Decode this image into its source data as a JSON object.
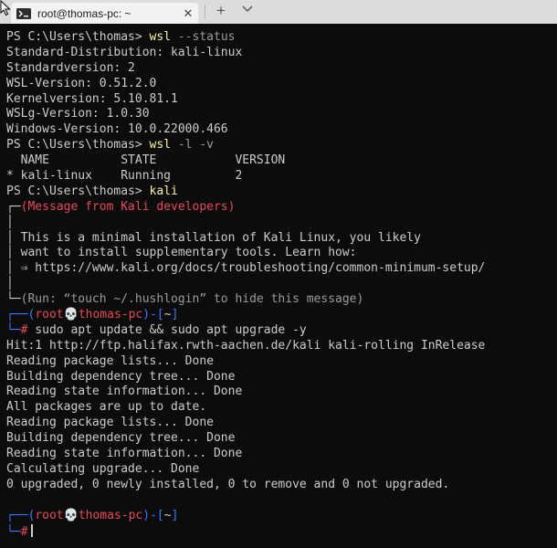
{
  "window": {
    "tab_title": "root@thomas-pc: ~",
    "close_glyph": "✕",
    "new_tab_glyph": "+"
  },
  "terminal": {
    "ps_prompt": "PS C:\\Users\\thomas> ",
    "cmd_wsl": "wsl",
    "cmd_status_arg": " --status",
    "status": [
      "Standard-Distribution: kali-linux",
      "Standardversion: 2",
      "WSL-Version: 0.51.2.0",
      "Kernelversion: 5.10.81.1",
      "WSLg-Version: 1.0.30",
      "Windows-Version: 10.0.22000.466"
    ],
    "cmd_list_arg": " -l -v",
    "list_header": "  NAME          STATE           VERSION",
    "list_row": "* kali-linux    Running         2",
    "cmd_kali": "kali",
    "banner": {
      "top_frame": "┌─",
      "title": "(Message from Kali developers)",
      "empty_line": "│",
      "line1": "│ This is a minimal installation of Kali Linux, you likely",
      "line2": "│ want to install supplementary tools. Learn how:",
      "line3": "│ ⇒ https://www.kali.org/docs/troubleshooting/common-minimum-setup/",
      "bottom_frame": "└─",
      "hint": "(Run: “touch ~/.hushlogin” to hide this message)"
    },
    "prompt": {
      "top": "┌──",
      "open_paren": "(",
      "user": "root",
      "skull": "💀",
      "host": "thomas-pc",
      "close_paren": ")",
      "dash": "-",
      "dir_open": "[",
      "dir": "~",
      "dir_close": "]",
      "bottom": "└─",
      "hash": "#"
    },
    "update_cmd": " sudo apt update && sudo apt upgrade -y",
    "output": [
      "Hit:1 http://ftp.halifax.rwth-aachen.de/kali kali-rolling InRelease",
      "Reading package lists... Done",
      "Building dependency tree... Done",
      "Reading state information... Done",
      "All packages are up to date.",
      "Reading package lists... Done",
      "Building dependency tree... Done",
      "Reading state information... Done",
      "Calculating upgrade... Done",
      "0 upgraded, 0 newly installed, 0 to remove and 0 not upgraded."
    ]
  }
}
